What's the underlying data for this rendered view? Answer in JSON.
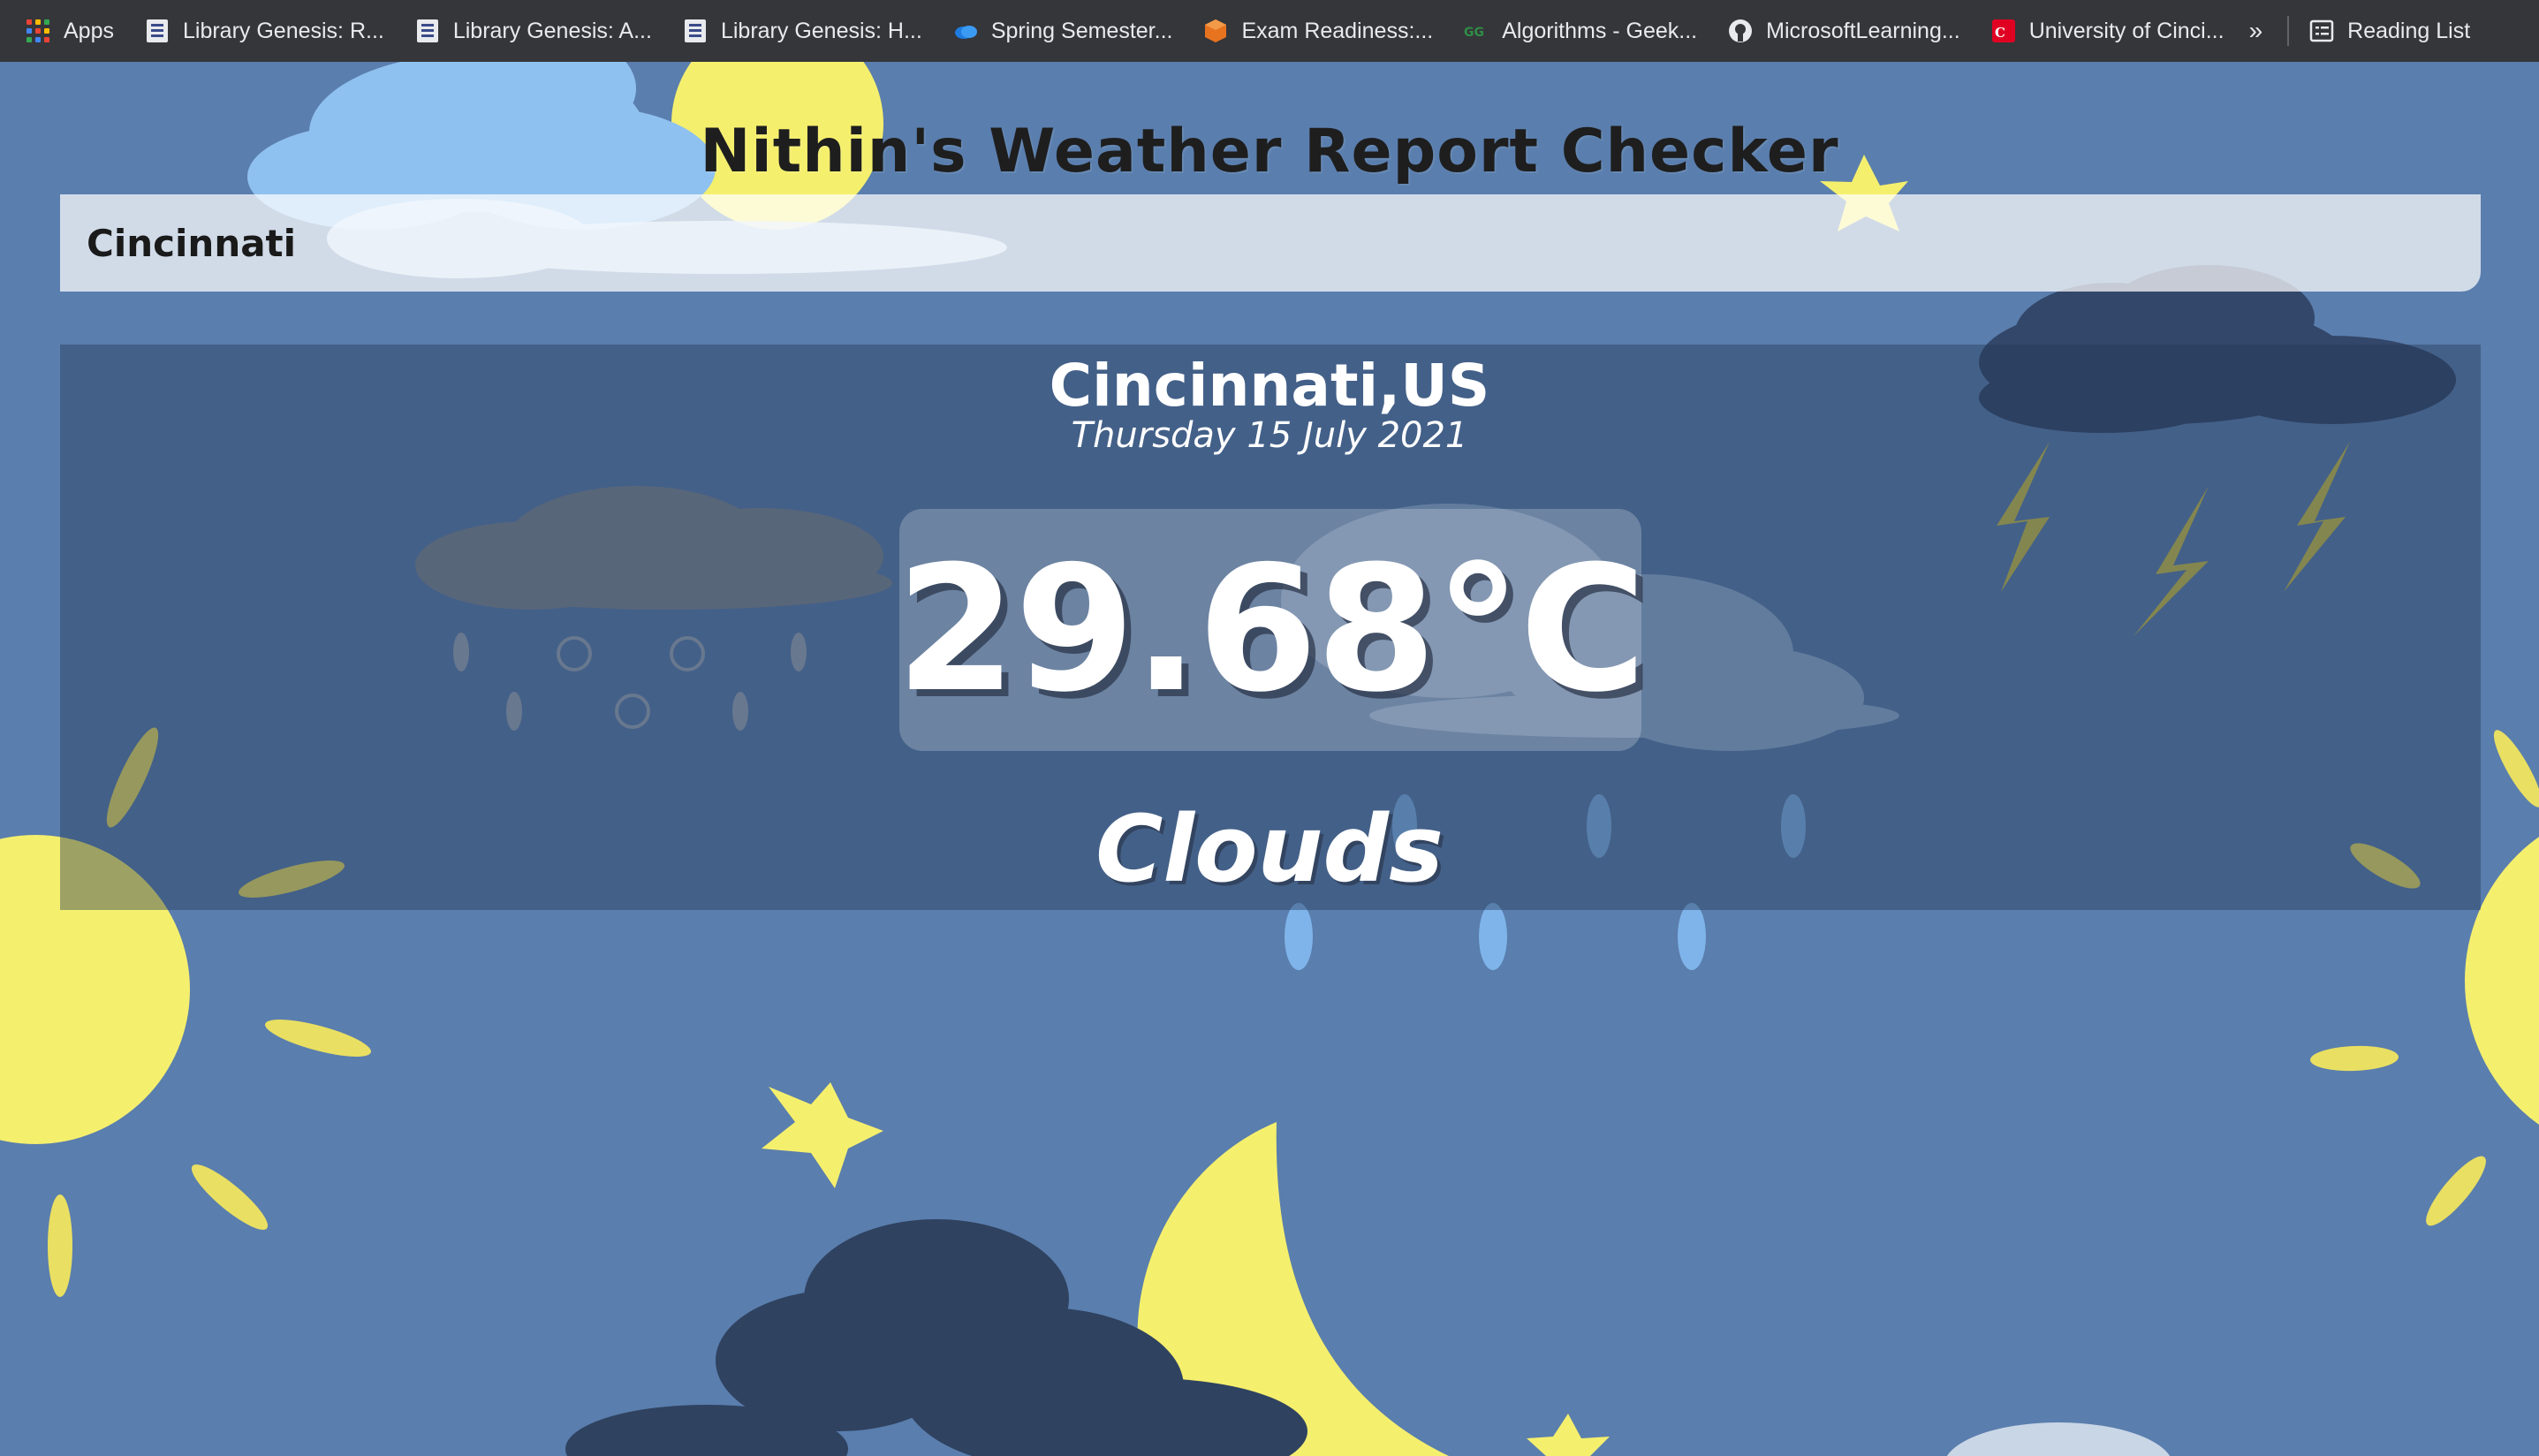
{
  "bookmarks": {
    "items": [
      {
        "label": "Apps",
        "icon": "apps-grid-icon"
      },
      {
        "label": "Library Genesis: R...",
        "icon": "library-genesis-icon"
      },
      {
        "label": "Library Genesis: A...",
        "icon": "library-genesis-icon"
      },
      {
        "label": "Library Genesis: H...",
        "icon": "library-genesis-icon"
      },
      {
        "label": "Spring Semester...",
        "icon": "onedrive-cloud-icon"
      },
      {
        "label": "Exam Readiness:...",
        "icon": "aws-cube-icon"
      },
      {
        "label": "Algorithms - Geek...",
        "icon": "geeksforgeeks-icon"
      },
      {
        "label": "MicrosoftLearning...",
        "icon": "github-icon"
      },
      {
        "label": "University of Cinci...",
        "icon": "uc-logo-icon"
      }
    ],
    "overflow_label": "»",
    "reading_list_label": "Reading List"
  },
  "app": {
    "title": "Nithin's Weather Report Checker",
    "search_value": "Cincinnati",
    "location": "Cincinnati,US",
    "date": "Thursday 15 July 2021",
    "temperature": "29.68°C",
    "condition": "Clouds"
  },
  "colors": {
    "background": "#5a7ead",
    "sun": "#f5ef6e",
    "dark_cloud": "#2f4260",
    "light_cloud": "#8fc1f0",
    "bookmark_bar": "#35363a"
  }
}
